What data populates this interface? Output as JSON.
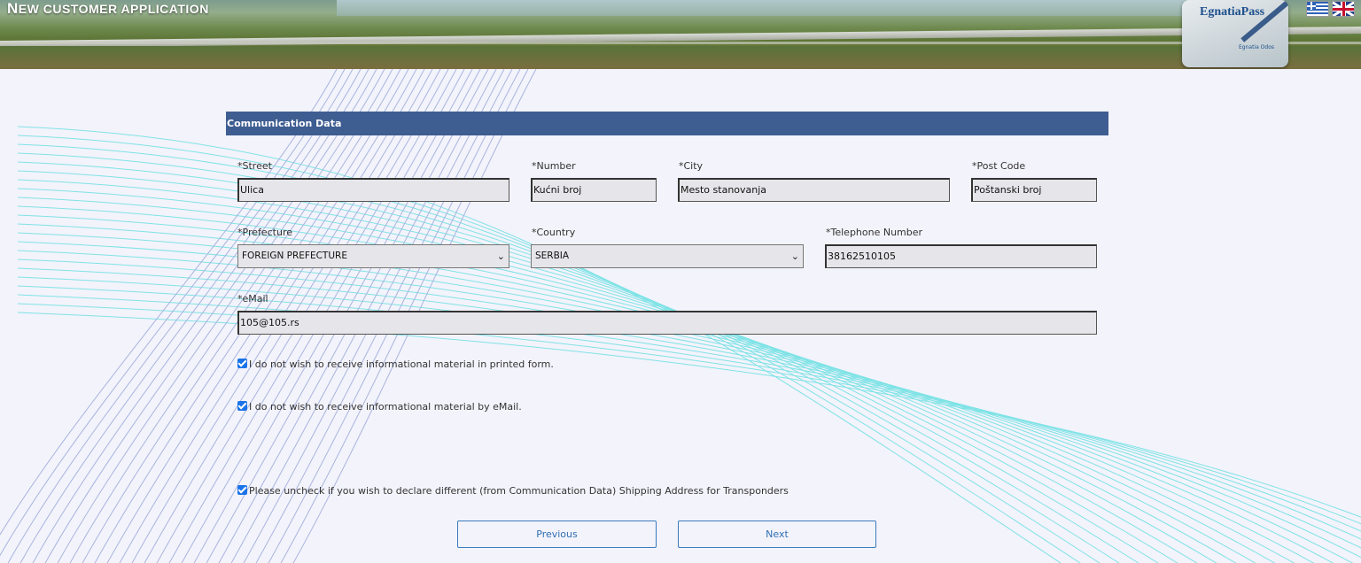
{
  "header": {
    "title_first": "N",
    "title_rest": "EW CUSTOMER APPLICATION",
    "logo_text": "EgnatiaPass",
    "logo_subtext": "Egnatia Odos",
    "flags": [
      "greek-flag-icon",
      "uk-flag-icon"
    ]
  },
  "section": {
    "title": "Communication Data"
  },
  "fields": {
    "street": {
      "label": "*Street",
      "value": "Ulica"
    },
    "number": {
      "label": "*Number",
      "value": "Kućni broj"
    },
    "city": {
      "label": "*City",
      "value": "Mesto stanovanja"
    },
    "post_code": {
      "label": "*Post Code",
      "value": "Poštanski broj"
    },
    "prefecture": {
      "label": "*Prefecture",
      "value": "FOREIGN PREFECTURE"
    },
    "country": {
      "label": "*Country",
      "value": "SERBIA"
    },
    "telephone": {
      "label": "*Telephone Number",
      "value": "38162510105"
    },
    "email": {
      "label": "*eMail",
      "value": "105@105.rs"
    }
  },
  "checkboxes": {
    "no_printed": {
      "label": "I do not wish to receive informational material in printed form.",
      "checked": true
    },
    "no_email": {
      "label": "I do not wish to receive informational material by eMail.",
      "checked": true
    },
    "same_shipping": {
      "label": "Please uncheck if you wish to declare different (from Communication Data) Shipping Address for Transponders",
      "checked": true
    }
  },
  "buttons": {
    "previous": "Previous",
    "next": "Next"
  },
  "colors": {
    "header_bar": "#3e5d91",
    "button_text": "#2f6fb3",
    "checkbox": "#1a73e8",
    "background": "#f3f3fb"
  }
}
